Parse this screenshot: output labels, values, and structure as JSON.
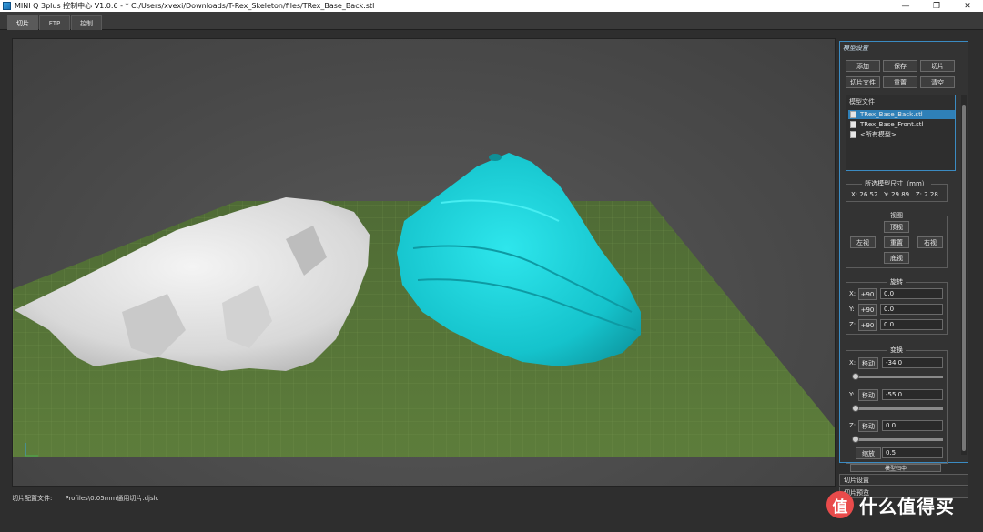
{
  "window": {
    "title": "MINI Q 3plus 控制中心 V1.0.6 - * C:/Users/xvexi/Downloads/T-Rex_Skeleton/files/TRex_Base_Back.stl",
    "controls": {
      "minimize": "—",
      "maximize": "❐",
      "close": "✕"
    }
  },
  "tabs": [
    {
      "label": "切片",
      "active": true
    },
    {
      "label": "FTP",
      "active": false
    },
    {
      "label": "控制",
      "active": false
    }
  ],
  "status": {
    "profile_label": "切片配置文件:",
    "profile_value": "Profiles\\0.05mm通用切片.djslc"
  },
  "model_settings": {
    "title": "模型设置",
    "buttons": {
      "add": "添加",
      "save": "保存",
      "slice": "切片",
      "slice_file": "切片文件",
      "reset": "重置",
      "clear": "清空"
    },
    "files_label": "模型文件",
    "files": [
      {
        "name": "TRex_Base_Back.stl",
        "selected": true
      },
      {
        "name": "TRex_Base_Front.stl",
        "selected": false
      },
      {
        "name": "<所有模型>",
        "selected": false
      }
    ],
    "dims": {
      "title": "所选模型尺寸（mm）",
      "x_label": "X:",
      "x": "26.52",
      "y_label": "Y:",
      "y": "29.89",
      "z_label": "Z:",
      "z": "2.28"
    },
    "view": {
      "title": "视图",
      "top": "顶视",
      "left": "左视",
      "reset": "重置",
      "right": "右视",
      "bottom": "底视"
    },
    "rotate": {
      "title": "旋转",
      "x_label": "X:",
      "x_btn": "+90",
      "x_val": "0.0",
      "y_label": "Y:",
      "y_btn": "+90",
      "y_val": "0.0",
      "z_label": "Z:",
      "z_btn": "+90",
      "z_val": "0.0"
    },
    "transform": {
      "title": "变换",
      "x_label": "X:",
      "x_btn": "移动",
      "x_val": "-34.0",
      "x_slider": 0.0,
      "y_label": "Y:",
      "y_btn": "移动",
      "y_val": "-55.0",
      "y_slider": 0.0,
      "z_label": "Z:",
      "z_btn": "移动",
      "z_val": "0.0",
      "z_slider": 0.0,
      "scale_btn": "缩放",
      "scale_val": "0.5",
      "center_btn": "模型归中"
    }
  },
  "sections": {
    "slice_settings": "切片设置",
    "slice_preview": "切片预览"
  },
  "watermark": {
    "logo_glyph": "值",
    "text": "什么值得买"
  },
  "colors": {
    "accent": "#3b8bc2",
    "model_cyan": "#1ec8d0",
    "model_gray": "#e8e8e8",
    "grid": "#5c7a3a"
  }
}
